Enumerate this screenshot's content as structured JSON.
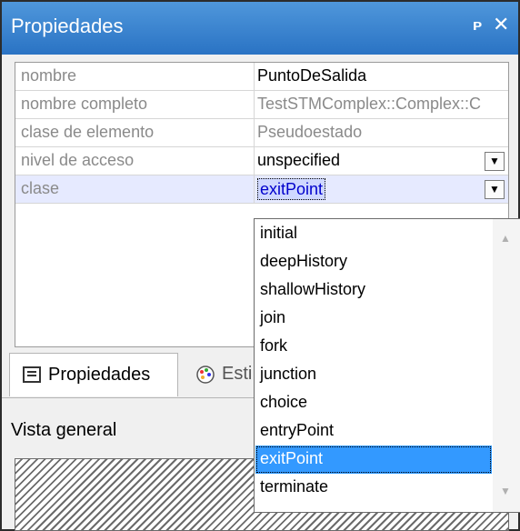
{
  "window": {
    "title": "Propiedades",
    "pin_glyph": "ᴘ",
    "close_glyph": "✕"
  },
  "properties": [
    {
      "name": "nombre",
      "value": "PuntoDeSalida"
    },
    {
      "name": "nombre completo",
      "value": "TestSTMComplex::Complex::C"
    },
    {
      "name": "clase de elemento",
      "value": "Pseudoestado"
    },
    {
      "name": "nivel de acceso",
      "value": "unspecified"
    },
    {
      "name": "clase",
      "value": "exitPoint"
    }
  ],
  "dropdown_arrow": "▼",
  "tabs": [
    {
      "label": "Propiedades",
      "icon": "list-icon"
    },
    {
      "label": "Esti",
      "icon": "palette-icon"
    }
  ],
  "overview_label": "Vista general",
  "dropdown": {
    "options": [
      "initial",
      "deepHistory",
      "shallowHistory",
      "join",
      "fork",
      "junction",
      "choice",
      "entryPoint",
      "exitPoint",
      "terminate"
    ],
    "selected": "exitPoint"
  },
  "colors": {
    "titlebar": "#3a86d4",
    "selection": "#3399ff",
    "editor_selection": "#cfd8ff"
  }
}
